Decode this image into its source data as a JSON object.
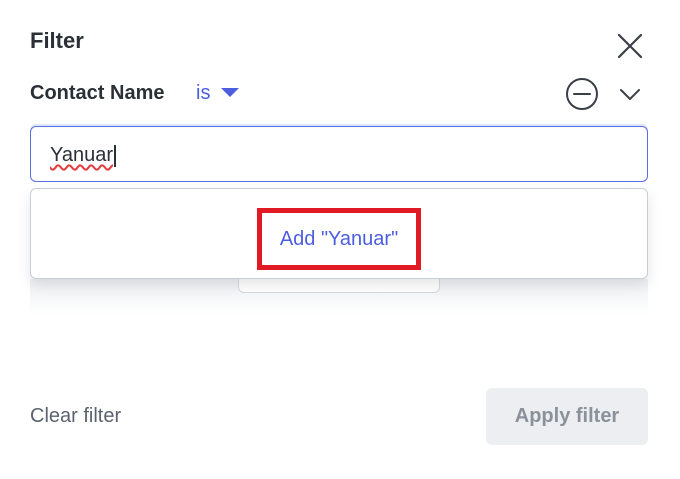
{
  "panel": {
    "title": "Filter"
  },
  "condition": {
    "field_label": "Contact Name",
    "operator": "is"
  },
  "search": {
    "value": "Yanuar"
  },
  "dropdown": {
    "add_option_label": "Add \"Yanuar\""
  },
  "footer": {
    "clear_label": "Clear filter",
    "apply_label": "Apply filter"
  },
  "icons": {
    "close": "close-icon",
    "operator_caret": "caret-down-icon",
    "remove": "minus-circle-icon",
    "collapse": "chevron-down-icon"
  },
  "colors": {
    "accent": "#4b5ee0",
    "highlight_border": "#e01b24",
    "apply_disabled_bg": "#eceef1"
  }
}
